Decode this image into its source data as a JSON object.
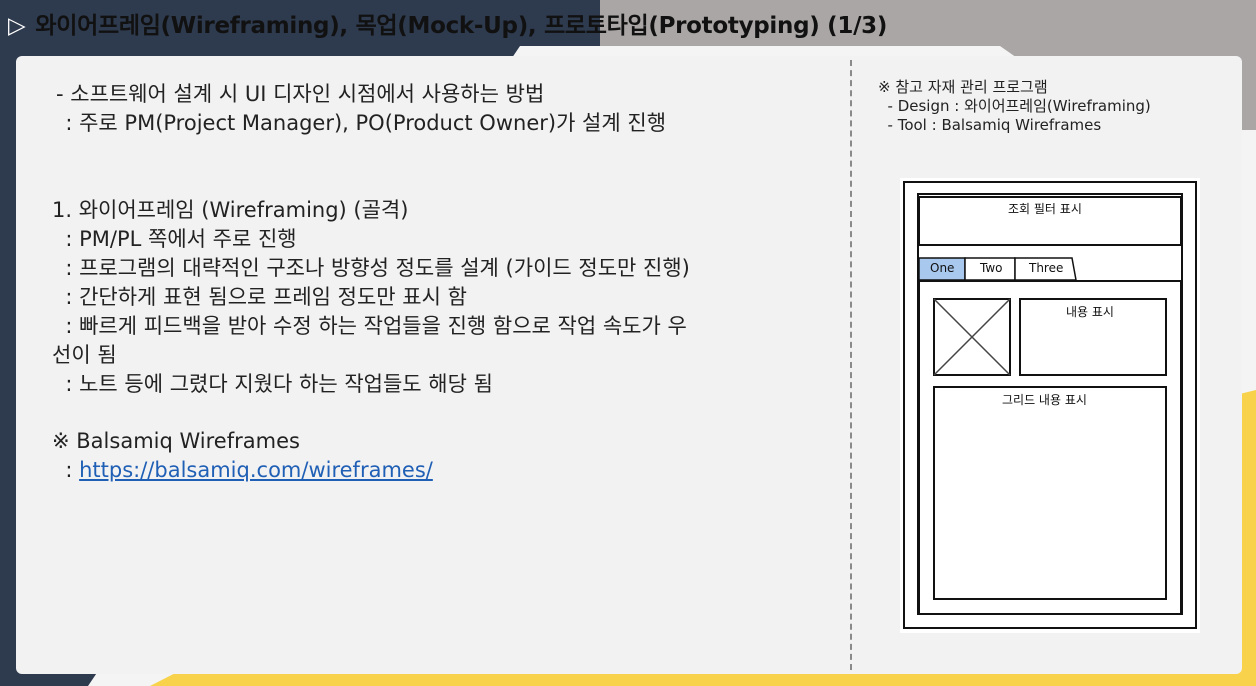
{
  "header": {
    "triangle": "▷",
    "title_main": "와이어프레임(Wireframing), 목업(Mock-Up), 프로토타입(Prototyping) (1/3)"
  },
  "left": {
    "intro_line1": "- 소프트웨어 설계 시 UI 디자인 시점에서 사용하는 방법",
    "intro_line2": "  : 주로 PM(Project Manager), PO(Product Owner)가 설계 진행",
    "section_title": "1. 와이어프레임 (Wireframing) (골격)",
    "bullets": [
      "  : PM/PL 쪽에서 주로 진행",
      "  : 프로그램의 대략적인 구조나 방향성 정도를 설계 (가이드 정도만 진행)",
      "  : 간단하게 표현 됨으로 프레임 정도만 표시 함",
      "  : 빠르게 피드백을 받아 수정 하는 작업들을 진행 함으로 작업 속도가 우",
      "선이 됨",
      "  : 노트 등에 그렸다 지웠다 하는 작업들도 해당 됨"
    ],
    "ref_title": "※ Balsamiq Wireframes",
    "ref_prefix": "  : ",
    "ref_link": "https://balsamiq.com/wireframes/"
  },
  "right": {
    "note_title": "※ 참고 자재 관리 프로그램",
    "note_design": "  - Design : 와이어프레임(Wireframing)",
    "note_tool": "  - Tool : Balsamiq Wireframes"
  },
  "wireframe": {
    "filter_label": "조회 필터 표시",
    "tabs": [
      "One",
      "Two",
      "Three"
    ],
    "content_label": "내용 표시",
    "grid_label": "그리드 내용 표시"
  },
  "colors": {
    "dark_navy": "#2e3a4e",
    "gray_band": "#aaa6a5",
    "yellow": "#f7d24a",
    "tab_selected": "#a8c8ee"
  }
}
